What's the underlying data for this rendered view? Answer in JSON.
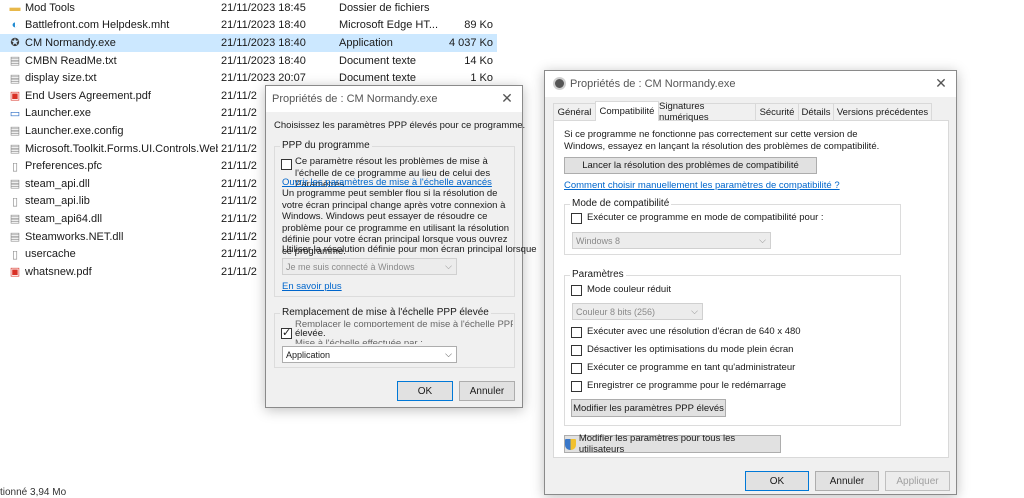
{
  "explorer": {
    "files": [
      {
        "name": "Mod Tools",
        "date": "21/11/2023 18:45",
        "type": "Dossier de fichiers",
        "size": "",
        "icon": "folder-icon"
      },
      {
        "name": "Battlefront.com Helpdesk.mht",
        "date": "21/11/2023 18:40",
        "type": "Microsoft Edge HT...",
        "size": "89 Ko",
        "icon": "edge-icon"
      },
      {
        "name": "CM Normandy.exe",
        "date": "21/11/2023 18:40",
        "type": "Application",
        "size": "4 037 Ko",
        "icon": "app-icon",
        "selected": true
      },
      {
        "name": "CMBN ReadMe.txt",
        "date": "21/11/2023 18:40",
        "type": "Document texte",
        "size": "14 Ko",
        "icon": "text-file-icon"
      },
      {
        "name": "display size.txt",
        "date": "21/11/2023 20:07",
        "type": "Document texte",
        "size": "1 Ko",
        "icon": "text-file-icon"
      },
      {
        "name": "End Users Agreement.pdf",
        "date": "21/11/2",
        "type": "",
        "size": "",
        "icon": "pdf-icon"
      },
      {
        "name": "Launcher.exe",
        "date": "21/11/2",
        "type": "",
        "size": "",
        "icon": "exe-icon"
      },
      {
        "name": "Launcher.exe.config",
        "date": "21/11/2",
        "type": "",
        "size": "",
        "icon": "config-file-icon"
      },
      {
        "name": "Microsoft.Toolkit.Forms.UI.Controls.WebV...",
        "date": "21/11/2",
        "type": "",
        "size": "",
        "icon": "dll-icon"
      },
      {
        "name": "Preferences.pfc",
        "date": "21/11/2",
        "type": "",
        "size": "",
        "icon": "file-icon"
      },
      {
        "name": "steam_api.dll",
        "date": "21/11/2",
        "type": "",
        "size": "",
        "icon": "dll-icon"
      },
      {
        "name": "steam_api.lib",
        "date": "21/11/2",
        "type": "",
        "size": "",
        "icon": "file-icon"
      },
      {
        "name": "steam_api64.dll",
        "date": "21/11/2",
        "type": "",
        "size": "",
        "icon": "dll-icon"
      },
      {
        "name": "Steamworks.NET.dll",
        "date": "21/11/2",
        "type": "",
        "size": "",
        "icon": "dll-icon"
      },
      {
        "name": "usercache",
        "date": "21/11/2",
        "type": "",
        "size": "",
        "icon": "file-icon"
      },
      {
        "name": "whatsnew.pdf",
        "date": "21/11/2",
        "type": "",
        "size": "",
        "icon": "pdf-icon"
      }
    ],
    "status_text": "tionné  3,94 Mo"
  },
  "dpi_dialog": {
    "title": "Propriétés de : CM Normandy.exe",
    "intro": "Choisissez les paramètres PPP élevés pour ce programme.",
    "program_group_title": "PPP du programme",
    "override_check_label": "Ce paramètre résout les problèmes de mise à l'échelle de ce programme au lieu de celui des Paramètres",
    "advanced_link": "Ouvrir les paramètres de mise à l'échelle avancés",
    "explain_text": "Un programme peut sembler flou si la résolution de votre écran principal change après votre connexion à Windows. Windows peut essayer de résoudre ce problème pour ce programme en utilisant la résolution définie pour votre écran principal lorsque vous ouvrez ce programme.",
    "use_resolution_label": "Utiliser la résolution définie pour mon écran principal lorsque",
    "connect_combo_value": "Je me suis connecté à Windows",
    "learn_more_link": "En savoir plus",
    "override_group_title": "Remplacement de mise à l'échelle PPP élevée",
    "override_line1": "Remplacer le comportement de mise à l'échelle PPP",
    "override_line2": "élevée.",
    "override_line3": "Mise à l'échelle effectuée par :",
    "scaling_combo_value": "Application",
    "ok_label": "OK",
    "cancel_label": "Annuler"
  },
  "compat_dialog": {
    "title": "Propriétés de : CM Normandy.exe",
    "tabs": [
      "Général",
      "Compatibilité",
      "Signatures numériques",
      "Sécurité",
      "Détails",
      "Versions précédentes"
    ],
    "active_tab": "Compatibilité",
    "intro": "Si ce programme ne fonctionne pas correctement sur cette version de Windows, essayez en lançant la résolution des problèmes de compatibilité.",
    "troubleshoot_button": "Lancer la résolution des problèmes de compatibilité",
    "manual_link": "Comment choisir manuellement les paramètres de compatibilité ?",
    "compat_mode_group": "Mode de compatibilité",
    "compat_mode_check": "Exécuter ce programme en mode de compatibilité pour :",
    "os_combo_value": "Windows 8",
    "settings_group": "Paramètres",
    "reduced_color_check": "Mode couleur réduit",
    "color_combo_value": "Couleur 8 bits (256)",
    "res_640_check": "Exécuter avec une résolution d'écran de 640 x 480",
    "fullscreen_opt_check": "Désactiver les optimisations du mode plein écran",
    "admin_check": "Exécuter ce programme en tant qu'administrateur",
    "restart_check": "Enregistrer ce programme pour le redémarrage",
    "dpi_button": "Modifier les paramètres PPP élevés",
    "all_users_button": "Modifier les paramètres pour tous les utilisateurs",
    "ok_label": "OK",
    "cancel_label": "Annuler",
    "apply_label": "Appliquer"
  }
}
